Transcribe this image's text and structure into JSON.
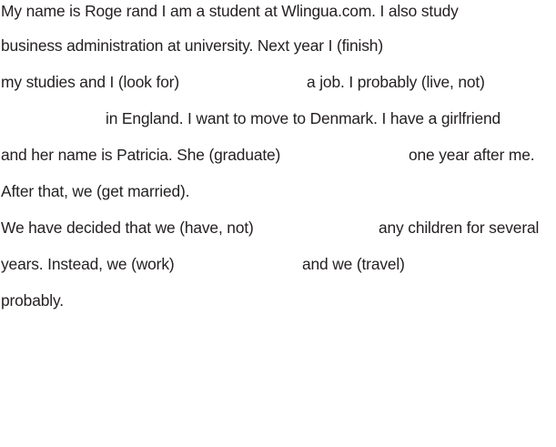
{
  "exercise": {
    "lines": [
      [
        "My name is Roge rand I am a student at Wlingua.com. I also study"
      ],
      [
        "business administration at university. Next year I (finish)"
      ],
      [
        "my studies and I (look for)",
        "a job. I probably (live, not)"
      ],
      [
        "in England.  I want to move to Denmark. I have a girlfriend"
      ],
      [
        "and her name is Patricia.  She (graduate)",
        "one year after me."
      ],
      [
        "After that, we (get married)."
      ],
      [
        "We have decided that we (have, not)",
        "any children for several"
      ],
      [
        "years.  Instead, we (work)",
        "and we (travel)"
      ],
      [
        "probably."
      ]
    ]
  }
}
